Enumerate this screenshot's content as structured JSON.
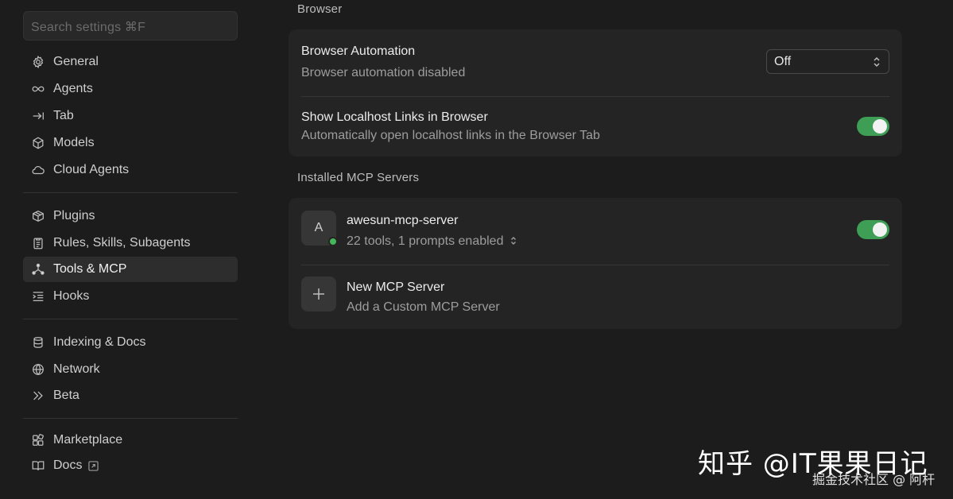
{
  "search": {
    "placeholder": "Search settings ⌘F"
  },
  "sidebar": {
    "groups": [
      [
        "General",
        "Agents",
        "Tab",
        "Models",
        "Cloud Agents"
      ],
      [
        "Plugins",
        "Rules, Skills, Subagents",
        "Tools & MCP",
        "Hooks"
      ],
      [
        "Indexing & Docs",
        "Network",
        "Beta"
      ],
      [
        "Marketplace",
        "Docs"
      ]
    ],
    "items": {
      "general": "General",
      "agents": "Agents",
      "tab": "Tab",
      "models": "Models",
      "cloud_agents": "Cloud Agents",
      "plugins": "Plugins",
      "rules": "Rules, Skills, Subagents",
      "tools_mcp": "Tools & MCP",
      "hooks": "Hooks",
      "indexing_docs": "Indexing & Docs",
      "network": "Network",
      "beta": "Beta",
      "marketplace": "Marketplace",
      "docs": "Docs"
    },
    "active": "Tools & MCP"
  },
  "browser": {
    "section_title": "Browser",
    "automation": {
      "title": "Browser Automation",
      "subtitle": "Browser automation disabled",
      "value": "Off"
    },
    "localhost": {
      "title": "Show Localhost Links in Browser",
      "subtitle": "Automatically open localhost links in the Browser Tab",
      "enabled": true
    }
  },
  "mcp": {
    "section_title": "Installed MCP Servers",
    "server": {
      "avatar": "A",
      "name": "awesun-mcp-server",
      "summary": "22 tools, 1 prompts enabled",
      "enabled": true,
      "status_color": "#46b65c"
    },
    "new_server": {
      "title": "New MCP Server",
      "subtitle": "Add a Custom MCP Server"
    }
  },
  "watermark": {
    "main": "知乎 @IT果果日记",
    "sub": "掘金技术社区 @ 阿杆"
  },
  "colors": {
    "toggle_on": "#3e9e55",
    "background": "#1c1c1c",
    "card": "#242424"
  }
}
